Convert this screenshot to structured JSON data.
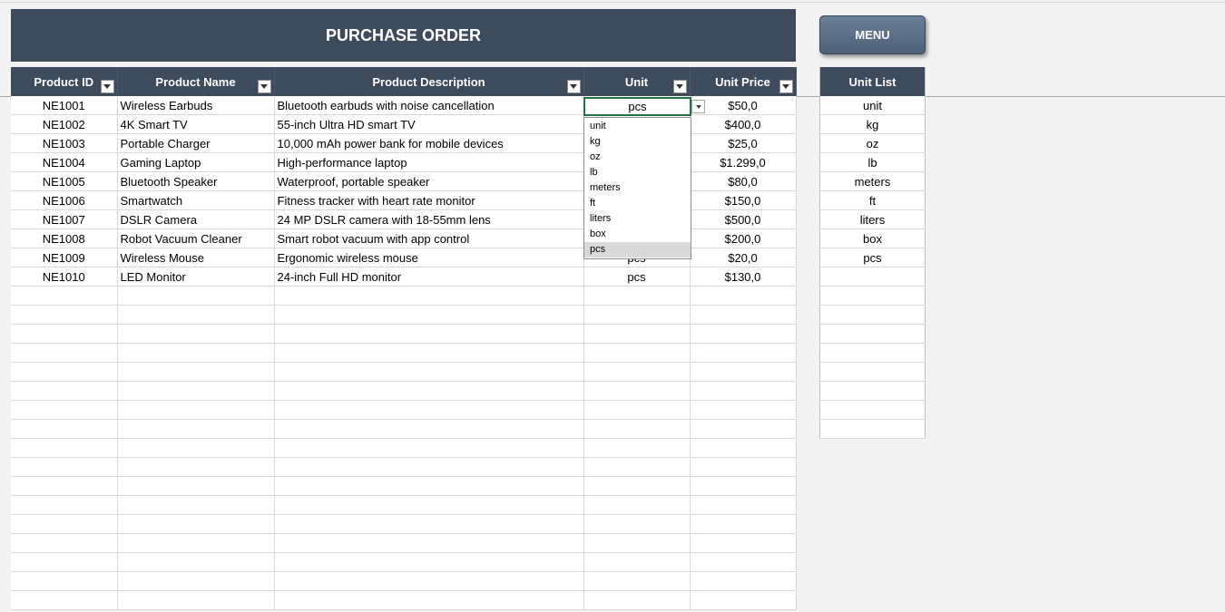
{
  "header": {
    "title": "PURCHASE ORDER",
    "menu_label": "MENU"
  },
  "table": {
    "columns": [
      "Product ID",
      "Product Name",
      "Product Description",
      "Unit",
      "Unit Price"
    ],
    "rows": [
      {
        "id": "NE1001",
        "name": "Wireless Earbuds",
        "desc": "Bluetooth earbuds with noise cancellation",
        "unit": "pcs",
        "price": "$50,0"
      },
      {
        "id": "NE1002",
        "name": "4K Smart TV",
        "desc": "55-inch Ultra HD smart TV",
        "unit": "",
        "price": "$400,0"
      },
      {
        "id": "NE1003",
        "name": "Portable Charger",
        "desc": "10,000 mAh power bank for mobile devices",
        "unit": "",
        "price": "$25,0"
      },
      {
        "id": "NE1004",
        "name": "Gaming Laptop",
        "desc": "High-performance laptop",
        "unit": "",
        "price": "$1.299,0"
      },
      {
        "id": "NE1005",
        "name": "Bluetooth Speaker",
        "desc": "Waterproof, portable speaker",
        "unit": "",
        "price": "$80,0"
      },
      {
        "id": "NE1006",
        "name": "Smartwatch",
        "desc": "Fitness tracker with heart rate monitor",
        "unit": "",
        "price": "$150,0"
      },
      {
        "id": "NE1007",
        "name": "DSLR Camera",
        "desc": "24 MP DSLR camera with 18-55mm lens",
        "unit": "",
        "price": "$500,0"
      },
      {
        "id": "NE1008",
        "name": "Robot Vacuum Cleaner",
        "desc": "Smart robot vacuum with app control",
        "unit": "",
        "price": "$200,0"
      },
      {
        "id": "NE1009",
        "name": "Wireless Mouse",
        "desc": "Ergonomic wireless mouse",
        "unit": "pcs",
        "price": "$20,0"
      },
      {
        "id": "NE1010",
        "name": "LED Monitor",
        "desc": "24-inch Full HD monitor",
        "unit": "pcs",
        "price": "$130,0"
      }
    ]
  },
  "unit_list": {
    "title": "Unit List",
    "items": [
      "unit",
      "kg",
      "oz",
      "lb",
      "meters",
      "ft",
      "liters",
      "box",
      "pcs"
    ]
  },
  "dropdown": {
    "current_value": "pcs",
    "options": [
      "unit",
      "kg",
      "oz",
      "lb",
      "meters",
      "ft",
      "liters",
      "box",
      "pcs"
    ],
    "selected": "pcs"
  },
  "colors": {
    "header_bg": "#3e4b5c",
    "active_cell_border": "#217346",
    "menu_button": "#5b6d86"
  }
}
